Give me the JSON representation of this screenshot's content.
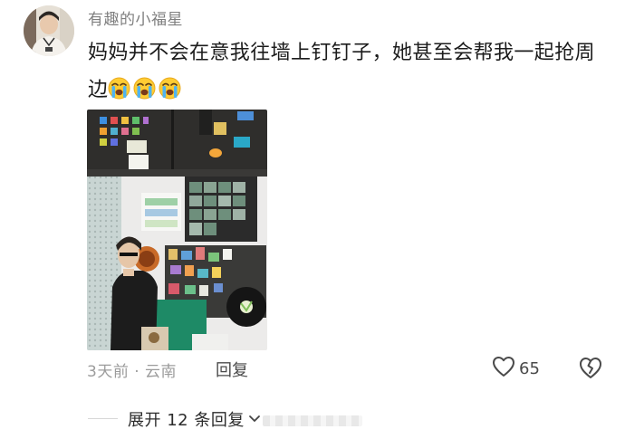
{
  "comment": {
    "username": "有趣的小福星",
    "text": "妈妈并不会在意我往墙上钉钉子，她甚至会帮我一起抢周边",
    "emojis": [
      "crying-face-icon",
      "crying-face-icon",
      "crying-face-icon"
    ],
    "meta": "3天前 · 云南",
    "reply_label": "回复",
    "like_count": "65",
    "expand_label": "展开 12 条回复"
  },
  "icons": {
    "like": "heart-outline-icon",
    "dislike": "broken-heart-outline-icon",
    "expand": "chevron-down-icon"
  },
  "colors": {
    "text": "#1c1c1c",
    "username": "#7f7f7f",
    "meta": "#9c9c9c",
    "action": "#4a4a4a"
  }
}
